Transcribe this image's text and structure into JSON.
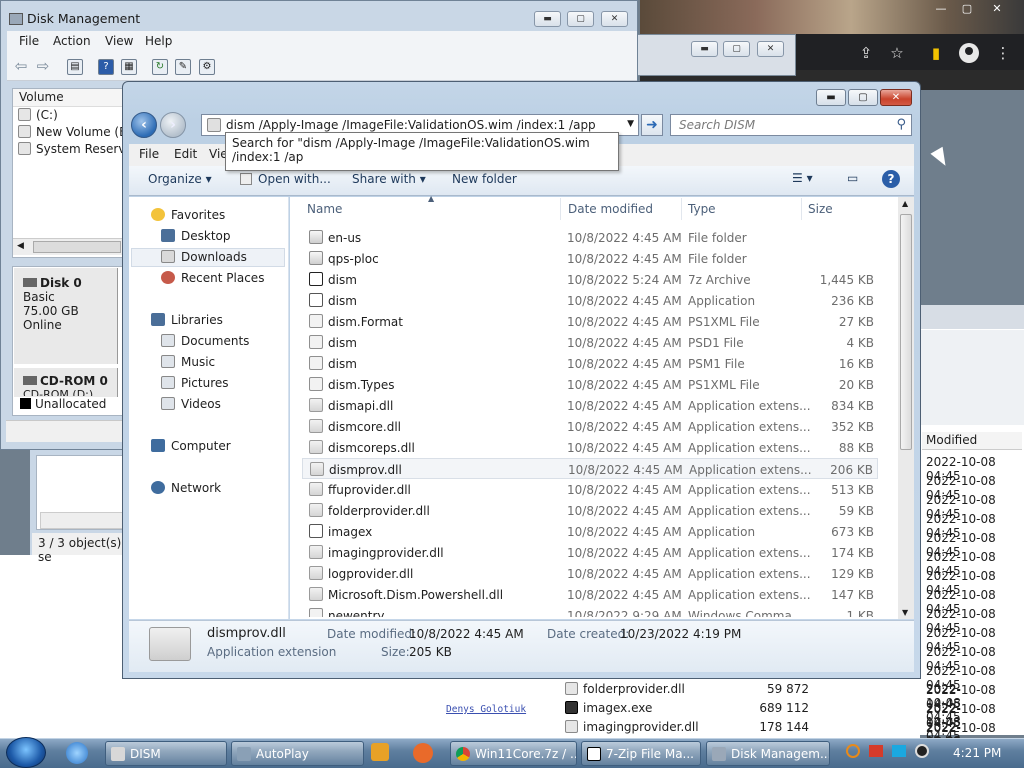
{
  "disk_mgmt": {
    "title": "Disk Management",
    "menu": [
      "File",
      "Action",
      "View",
      "Help"
    ],
    "volume_header": "Volume",
    "volumes": [
      "(C:)",
      "New Volume (E:)",
      "System Reserved"
    ],
    "disk0": {
      "name": "Disk 0",
      "type": "Basic",
      "size": "75.00 GB",
      "status": "Online"
    },
    "cdrom": {
      "name": "CD-ROM 0",
      "sub": "CD-ROM (D:)"
    },
    "legend_unallocated": "Unallocated"
  },
  "behind_window": {
    "status": "3 / 3 object(s) se"
  },
  "explorer": {
    "address": "dism /Apply-Image /ImageFile:ValidationOS.wim /index:1 /app",
    "search_placeholder": "Search DISM",
    "tooltip": "Search for \"dism /Apply-Image /ImageFile:ValidationOS.wim /index:1 /ap",
    "menu": {
      "file": "File",
      "edit": "Edit",
      "view": "Vie"
    },
    "commands": {
      "organize": "Organize",
      "open_with": "Open with...",
      "share_with": "Share with",
      "new_folder": "New folder"
    },
    "nav": {
      "favorites": "Favorites",
      "desktop": "Desktop",
      "downloads": "Downloads",
      "recent": "Recent Places",
      "libraries": "Libraries",
      "documents": "Documents",
      "music": "Music",
      "pictures": "Pictures",
      "videos": "Videos",
      "computer": "Computer",
      "network": "Network"
    },
    "columns": {
      "name": "Name",
      "date": "Date modified",
      "type": "Type",
      "size": "Size"
    },
    "files": [
      {
        "name": "en-us",
        "date": "10/8/2022 4:45 AM",
        "type": "File folder",
        "size": "",
        "icon": "folder-icon"
      },
      {
        "name": "qps-ploc",
        "date": "10/8/2022 4:45 AM",
        "type": "File folder",
        "size": "",
        "icon": "folder-icon"
      },
      {
        "name": "dism",
        "date": "10/8/2022 5:24 AM",
        "type": "7z Archive",
        "size": "1,445 KB",
        "icon": "7z-archive-icon"
      },
      {
        "name": "dism",
        "date": "10/8/2022 4:45 AM",
        "type": "Application",
        "size": "236 KB",
        "icon": "application-icon"
      },
      {
        "name": "dism.Format",
        "date": "10/8/2022 4:45 AM",
        "type": "PS1XML File",
        "size": "27 KB",
        "icon": "document-icon"
      },
      {
        "name": "dism",
        "date": "10/8/2022 4:45 AM",
        "type": "PSD1 File",
        "size": "4 KB",
        "icon": "document-icon"
      },
      {
        "name": "dism",
        "date": "10/8/2022 4:45 AM",
        "type": "PSM1 File",
        "size": "16 KB",
        "icon": "document-icon"
      },
      {
        "name": "dism.Types",
        "date": "10/8/2022 4:45 AM",
        "type": "PS1XML File",
        "size": "20 KB",
        "icon": "document-icon"
      },
      {
        "name": "dismapi.dll",
        "date": "10/8/2022 4:45 AM",
        "type": "Application extens...",
        "size": "834 KB",
        "icon": "dll-icon"
      },
      {
        "name": "dismcore.dll",
        "date": "10/8/2022 4:45 AM",
        "type": "Application extens...",
        "size": "352 KB",
        "icon": "dll-icon"
      },
      {
        "name": "dismcoreps.dll",
        "date": "10/8/2022 4:45 AM",
        "type": "Application extens...",
        "size": "88 KB",
        "icon": "dll-icon"
      },
      {
        "name": "dismprov.dll",
        "date": "10/8/2022 4:45 AM",
        "type": "Application extens...",
        "size": "206 KB",
        "icon": "dll-icon"
      },
      {
        "name": "ffuprovider.dll",
        "date": "10/8/2022 4:45 AM",
        "type": "Application extens...",
        "size": "513 KB",
        "icon": "dll-icon"
      },
      {
        "name": "folderprovider.dll",
        "date": "10/8/2022 4:45 AM",
        "type": "Application extens...",
        "size": "59 KB",
        "icon": "dll-icon"
      },
      {
        "name": "imagex",
        "date": "10/8/2022 4:45 AM",
        "type": "Application",
        "size": "673 KB",
        "icon": "application-icon"
      },
      {
        "name": "imagingprovider.dll",
        "date": "10/8/2022 4:45 AM",
        "type": "Application extens...",
        "size": "174 KB",
        "icon": "dll-icon"
      },
      {
        "name": "logprovider.dll",
        "date": "10/8/2022 4:45 AM",
        "type": "Application extens...",
        "size": "129 KB",
        "icon": "dll-icon"
      },
      {
        "name": "Microsoft.Dism.Powershell.dll",
        "date": "10/8/2022 4:45 AM",
        "type": "Application extens...",
        "size": "147 KB",
        "icon": "dll-icon"
      },
      {
        "name": "newentry",
        "date": "10/8/2022 9:29 AM",
        "type": "Windows Comma...",
        "size": "1 KB",
        "icon": "document-icon"
      }
    ],
    "details": {
      "name": "dismprov.dll",
      "type": "Application extension",
      "date_modified_label": "Date modified:",
      "date_modified": "10/8/2022 4:45 AM",
      "size_label": "Size:",
      "size": "205 KB",
      "date_created_label": "Date created:",
      "date_created": "10/23/2022 4:19 PM"
    }
  },
  "zip_window": {
    "modified_header": "Modified",
    "modified_values": [
      "2022-10-08 04:45",
      "2022-10-08 04:45",
      "2022-10-08 04:45",
      "2022-10-08 04:45",
      "2022-10-08 04:45",
      "2022-10-08 04:45",
      "2022-10-08 04:45",
      "2022-10-08 04:45",
      "2022-10-08 04:45",
      "2022-10-08 04:45",
      "2022-10-08 04:45",
      "2022-10-08 04:45",
      "2022-10-08 04:45",
      "2022-10-08 04:45",
      "2022-10-08 04:45",
      "2022-10-08 04:45"
    ],
    "bottom_rows": [
      {
        "name": "folderprovider.dll",
        "size": "59 872",
        "modified": "2022-10-08 04:45",
        "icon": "dll-icon"
      },
      {
        "name": "imagex.exe",
        "size": "689 112",
        "modified": "2022-10-08 04:45",
        "icon": "exe-icon"
      },
      {
        "name": "imagingprovider.dll",
        "size": "178 144",
        "modified": "2022-10-08 04:45",
        "icon": "dll-icon"
      }
    ]
  },
  "watermark": "Denys Golotiuk",
  "taskbar": {
    "items": [
      "DISM",
      "AutoPlay",
      "Win11Core.7z / ...",
      "7-Zip File Ma...",
      "Disk Managem..."
    ],
    "time": "4:21 PM"
  }
}
